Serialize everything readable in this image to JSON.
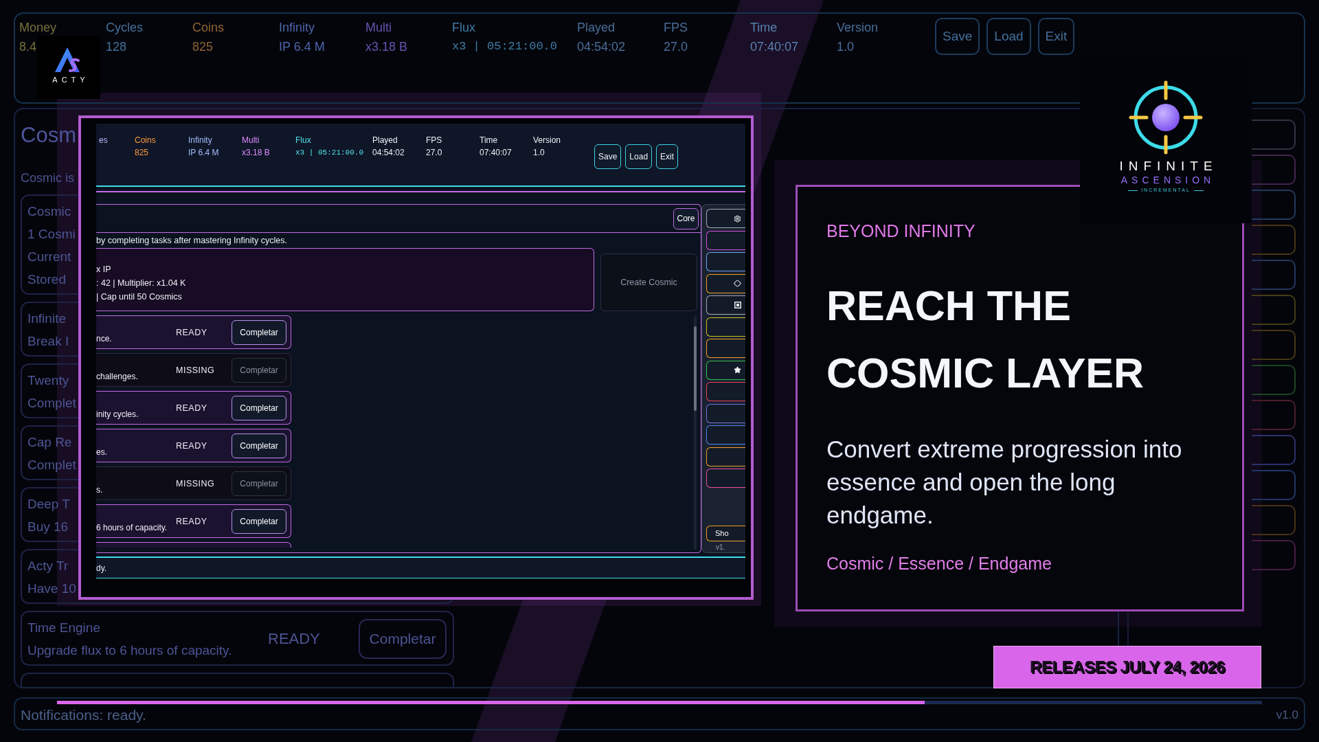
{
  "top_bar": {
    "stats": [
      {
        "label": "Money",
        "value": "8.4",
        "kind": "plain",
        "color": "#77713a"
      },
      {
        "label": "Cycles",
        "value": "128",
        "kind": "plain",
        "color": "#44709a"
      },
      {
        "label": "Coins",
        "value": "825",
        "kind": "plain",
        "color": "#8f6436"
      },
      {
        "label": "Infinity",
        "value": "IP 6.4 M",
        "kind": "plain",
        "color": "#4c66aa"
      },
      {
        "label": "Multi",
        "value": "x3.18 B",
        "kind": "plain",
        "color": "#6654b0"
      },
      {
        "label": "Flux",
        "value": "x3 | 05:21:00.0",
        "kind": "timer",
        "color": "#3f7ea6"
      },
      {
        "label": "Played",
        "value": "04:54:02",
        "kind": "plain",
        "color": "#4a6f9a"
      },
      {
        "label": "FPS",
        "value": "27.0",
        "kind": "plain",
        "color": "#4a6f9a"
      },
      {
        "label": "Time",
        "value": "07:40:07",
        "kind": "plain",
        "color": "#5a82b0"
      },
      {
        "label": "Version",
        "value": "1.0",
        "kind": "plain",
        "color": "#4a6f9a"
      }
    ],
    "buttons": [
      "Save",
      "Load",
      "Exit"
    ]
  },
  "studio_logo": {
    "name": "ACTY"
  },
  "main_panel": {
    "title": "Cosm",
    "intro": "Cosmic is",
    "tasks": [
      {
        "lines": [
          "Cosmic",
          "1 Cosmi",
          "Current",
          "Stored"
        ]
      },
      {
        "lines": [
          "Infinite",
          "Break I"
        ]
      },
      {
        "lines": [
          "Twenty",
          "Complet"
        ]
      },
      {
        "lines": [
          "Cap Re",
          "Complet"
        ]
      },
      {
        "lines": [
          "Deep T",
          "Buy 16"
        ]
      },
      {
        "lines": [
          "Acty Tr",
          "Have 10"
        ]
      },
      {
        "lines": [
          "Time Engine",
          "Upgrade flux to 6 hours of capacity."
        ],
        "status": "READY",
        "button": "Completar"
      }
    ]
  },
  "side_menu": {
    "items": [
      {
        "color": "#2e3442"
      },
      {
        "color": "#42264c"
      },
      {
        "color": "#223a5e"
      },
      {
        "color": "#4a3414"
      },
      {
        "color": "#243660"
      },
      {
        "color": "#443e14"
      },
      {
        "color": "#463814"
      },
      {
        "color": "#1c4622"
      },
      {
        "color": "#4a1e2a"
      },
      {
        "color": "#2c306c"
      },
      {
        "color": "#213666"
      },
      {
        "color": "#4a3214"
      },
      {
        "color": "#461c42"
      }
    ]
  },
  "notification_bar": {
    "text": "Notifications: ready.",
    "level": 0.72,
    "version": "v1.0"
  },
  "screenshot": {
    "stats": [
      {
        "label": "es",
        "kind": "cut",
        "color": "#c4b5fd"
      },
      {
        "label": "Coins",
        "value": "825",
        "kind": "plain",
        "color": "#ff9a3d"
      },
      {
        "label": "Infinity",
        "value": "IP 6.4 M",
        "kind": "plain",
        "color": "#a5bdff"
      },
      {
        "label": "Multi",
        "value": "x3.18 B",
        "kind": "plain",
        "color": "#e08cff"
      },
      {
        "label": "Flux",
        "value": "x3 | 05:21:00.0",
        "kind": "timer",
        "color": "#52e5ee"
      },
      {
        "label": "Played",
        "value": "04:54:02",
        "kind": "plain",
        "color": "#eef0f6"
      },
      {
        "label": "FPS",
        "value": "27.0",
        "kind": "plain",
        "color": "#eef0f6"
      },
      {
        "label": "Time",
        "value": "07:40:07",
        "kind": "plain",
        "color": "#eef0f6"
      },
      {
        "label": "Version",
        "value": "1.0",
        "kind": "plain",
        "color": "#eef0f6"
      }
    ],
    "buttons": [
      "Save",
      "Load",
      "Exit"
    ],
    "core_button": "Core",
    "description": "by completing tasks after mastering Infinity cycles.",
    "info_lines": [
      "x IP",
      ": 42 | Multiplier: x1.04 K",
      "| Cap until 50 Cosmics"
    ],
    "create_button": {
      "label": "Create Cosmic",
      "disabled": true
    },
    "tasks": [
      {
        "text": "nce.",
        "status": "READY",
        "button": "Completar",
        "enabled": true
      },
      {
        "text": "challenges.",
        "status": "MISSING",
        "button": "Completar",
        "enabled": false
      },
      {
        "text": "inity cycles.",
        "status": "READY",
        "button": "Completar",
        "enabled": true
      },
      {
        "text": "es.",
        "status": "READY",
        "button": "Completar",
        "enabled": true
      },
      {
        "text": "s.",
        "status": "MISSING",
        "button": "Completar",
        "enabled": false
      },
      {
        "text": "6 hours of capacity.",
        "status": "READY",
        "button": "Completar",
        "enabled": true
      }
    ],
    "menu": [
      {
        "color": "#a3a9b5",
        "kind": "gear"
      },
      {
        "color": "#d24fe2",
        "kind": "plain"
      },
      {
        "color": "#6aa8f0",
        "kind": "plain"
      },
      {
        "color": "#f0a020",
        "kind": "diamond"
      },
      {
        "color": "#a3a9b5",
        "kind": "square"
      },
      {
        "color": "#cfc21c",
        "kind": "plain"
      },
      {
        "color": "#f0a020",
        "kind": "plain"
      },
      {
        "color": "#2fc44f",
        "kind": "star"
      },
      {
        "color": "#ec3f62",
        "kind": "plain"
      },
      {
        "color": "#6f72e0",
        "kind": "plain"
      },
      {
        "color": "#4a86f0",
        "kind": "plain"
      },
      {
        "color": "#f0a020",
        "kind": "plain"
      },
      {
        "color": "#ea4f9a",
        "kind": "plain"
      }
    ],
    "shop_button": "Sho",
    "version": "v1.",
    "notification": "dy."
  },
  "promo_card": {
    "eyebrow": "BEYOND INFINITY",
    "headline": [
      "REACH THE",
      "COSMIC LAYER"
    ],
    "body": "Convert extreme progression into essence and open the long endgame.",
    "tags": "Cosmic / Essence / Endgame"
  },
  "game_logo": {
    "title": "INFINITE",
    "subtitle": "ASCENSION",
    "tagline": "INCREMENTAL"
  },
  "release_banner": {
    "text": "RELEASES JULY 24, 2026"
  }
}
